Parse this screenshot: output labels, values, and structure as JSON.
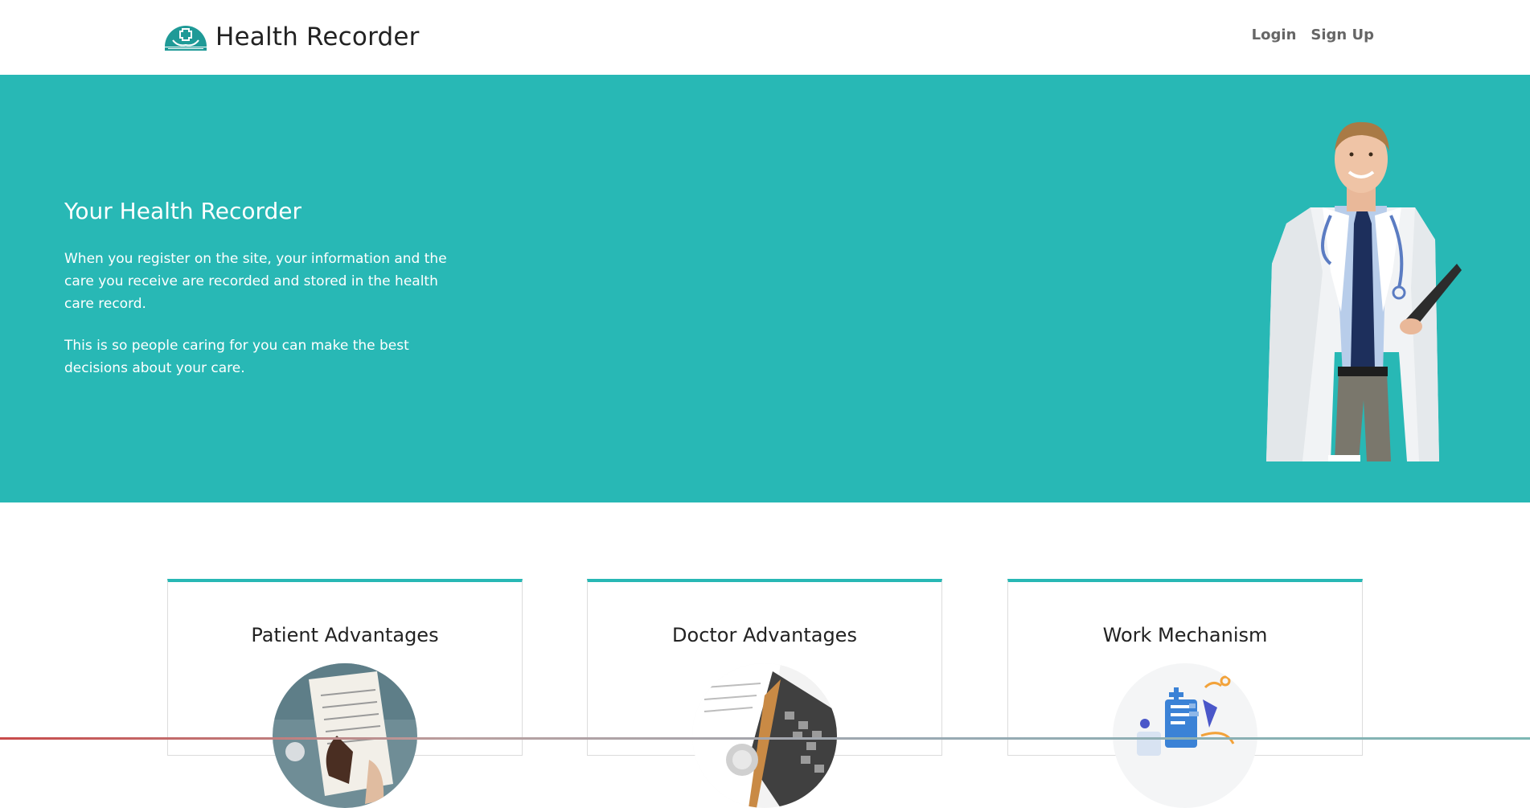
{
  "navbar": {
    "brand_name": "Health Recorder",
    "links": [
      {
        "label": "Login"
      },
      {
        "label": "Sign Up"
      }
    ]
  },
  "hero": {
    "title": "Your Health Recorder",
    "paragraphs": [
      "When you register on the site, your information and the care you receive are recorded and stored in the health care record.",
      "This is so people caring for you can make the best decisions about your care."
    ]
  },
  "cards": [
    {
      "title": "Patient Advantages",
      "image": "patient-clipboard-photo"
    },
    {
      "title": "Doctor Advantages",
      "image": "doctor-stethoscope-keyboard-photo"
    },
    {
      "title": "Work Mechanism",
      "image": "medical-record-illustration"
    }
  ],
  "colors": {
    "accent": "#28b8b5",
    "nav_link": "#666666",
    "text_dark": "#222222"
  }
}
